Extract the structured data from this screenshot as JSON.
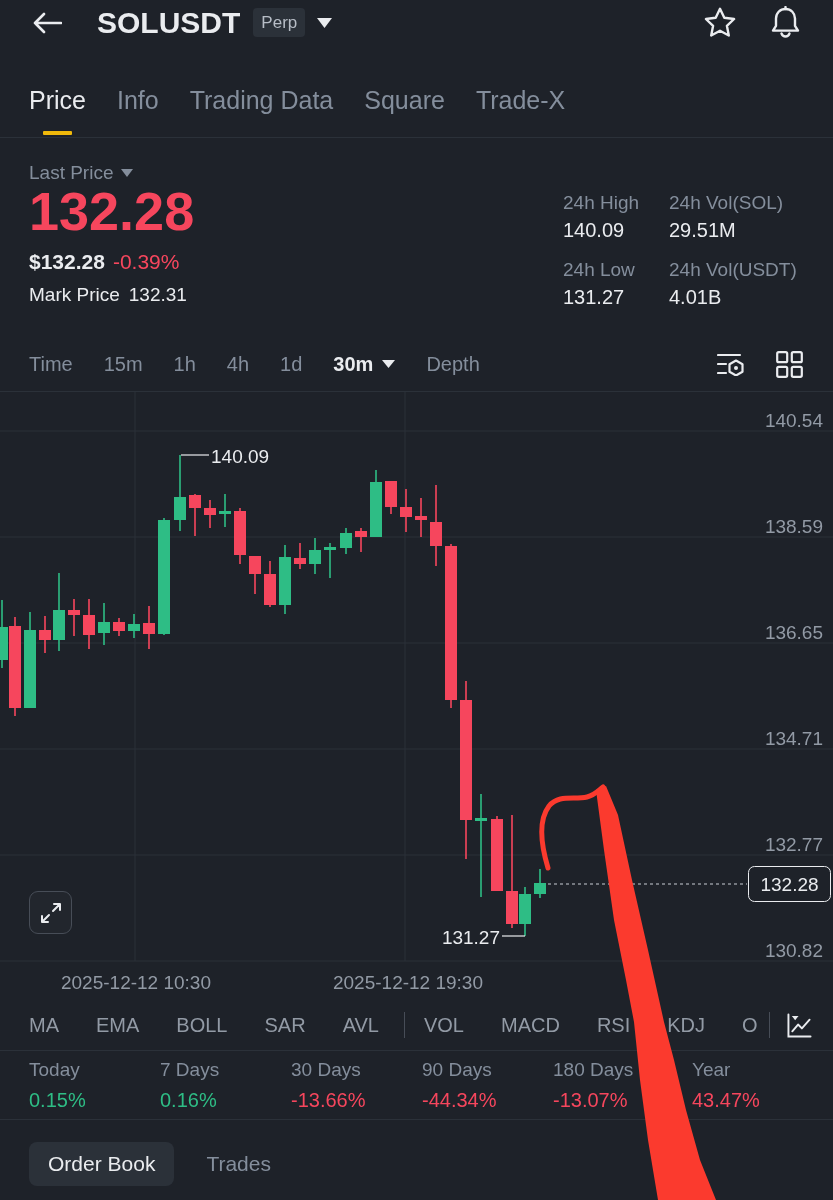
{
  "header": {
    "symbol": "SOLUSDT",
    "badge": "Perp"
  },
  "tabs": [
    {
      "label": "Price",
      "selected": true
    },
    {
      "label": "Info",
      "selected": false
    },
    {
      "label": "Trading Data",
      "selected": false
    },
    {
      "label": "Square",
      "selected": false
    },
    {
      "label": "Trade-X",
      "selected": false
    }
  ],
  "price": {
    "label": "Last Price",
    "last": "132.28",
    "usd": "$132.28",
    "change": "-0.39%",
    "mark_label": "Mark Price",
    "mark_value": "132.31"
  },
  "stats": [
    {
      "label": "24h High",
      "value": "140.09"
    },
    {
      "label": "24h Vol(SOL)",
      "value": "29.51M"
    },
    {
      "label": "24h Low",
      "value": "131.27"
    },
    {
      "label": "24h Vol(USDT)",
      "value": "4.01B"
    }
  ],
  "intervals": [
    {
      "label": "Time",
      "kind": "option",
      "selected": false
    },
    {
      "label": "15m",
      "kind": "option",
      "selected": false
    },
    {
      "label": "1h",
      "kind": "option",
      "selected": false
    },
    {
      "label": "4h",
      "kind": "option",
      "selected": false
    },
    {
      "label": "1d",
      "kind": "option",
      "selected": false
    },
    {
      "label": "30m",
      "kind": "dropdown",
      "selected": true
    },
    {
      "label": "Depth",
      "kind": "option",
      "selected": false
    }
  ],
  "chart": {
    "price_axis": [
      "140.54",
      "138.59",
      "136.65",
      "134.71",
      "132.77",
      "130.82"
    ],
    "time_axis": [
      "2025-12-12 10:30",
      "2025-12-12 19:30"
    ],
    "high_label": "140.09",
    "low_label": "131.27",
    "current_price": "132.28"
  },
  "indicators": {
    "main": [
      "MA",
      "EMA",
      "BOLL",
      "SAR",
      "AVL"
    ],
    "sub": [
      "VOL",
      "MACD",
      "RSI",
      "KDJ",
      "O"
    ]
  },
  "performance": [
    {
      "label": "Today",
      "value": "0.15%",
      "color": "#2ebd85"
    },
    {
      "label": "7 Days",
      "value": "0.16%",
      "color": "#2ebd85"
    },
    {
      "label": "30 Days",
      "value": "-13.66%",
      "color": "#f6465d"
    },
    {
      "label": "90 Days",
      "value": "-44.34%",
      "color": "#f6465d"
    },
    {
      "label": "180 Days",
      "value": "-13.07%",
      "color": "#f6465d"
    },
    {
      "label": "Year",
      "value": "43.47%",
      "color": "#f6465d"
    }
  ],
  "book_tabs": [
    {
      "label": "Order Book",
      "selected": true
    },
    {
      "label": "Trades",
      "selected": false
    }
  ]
}
